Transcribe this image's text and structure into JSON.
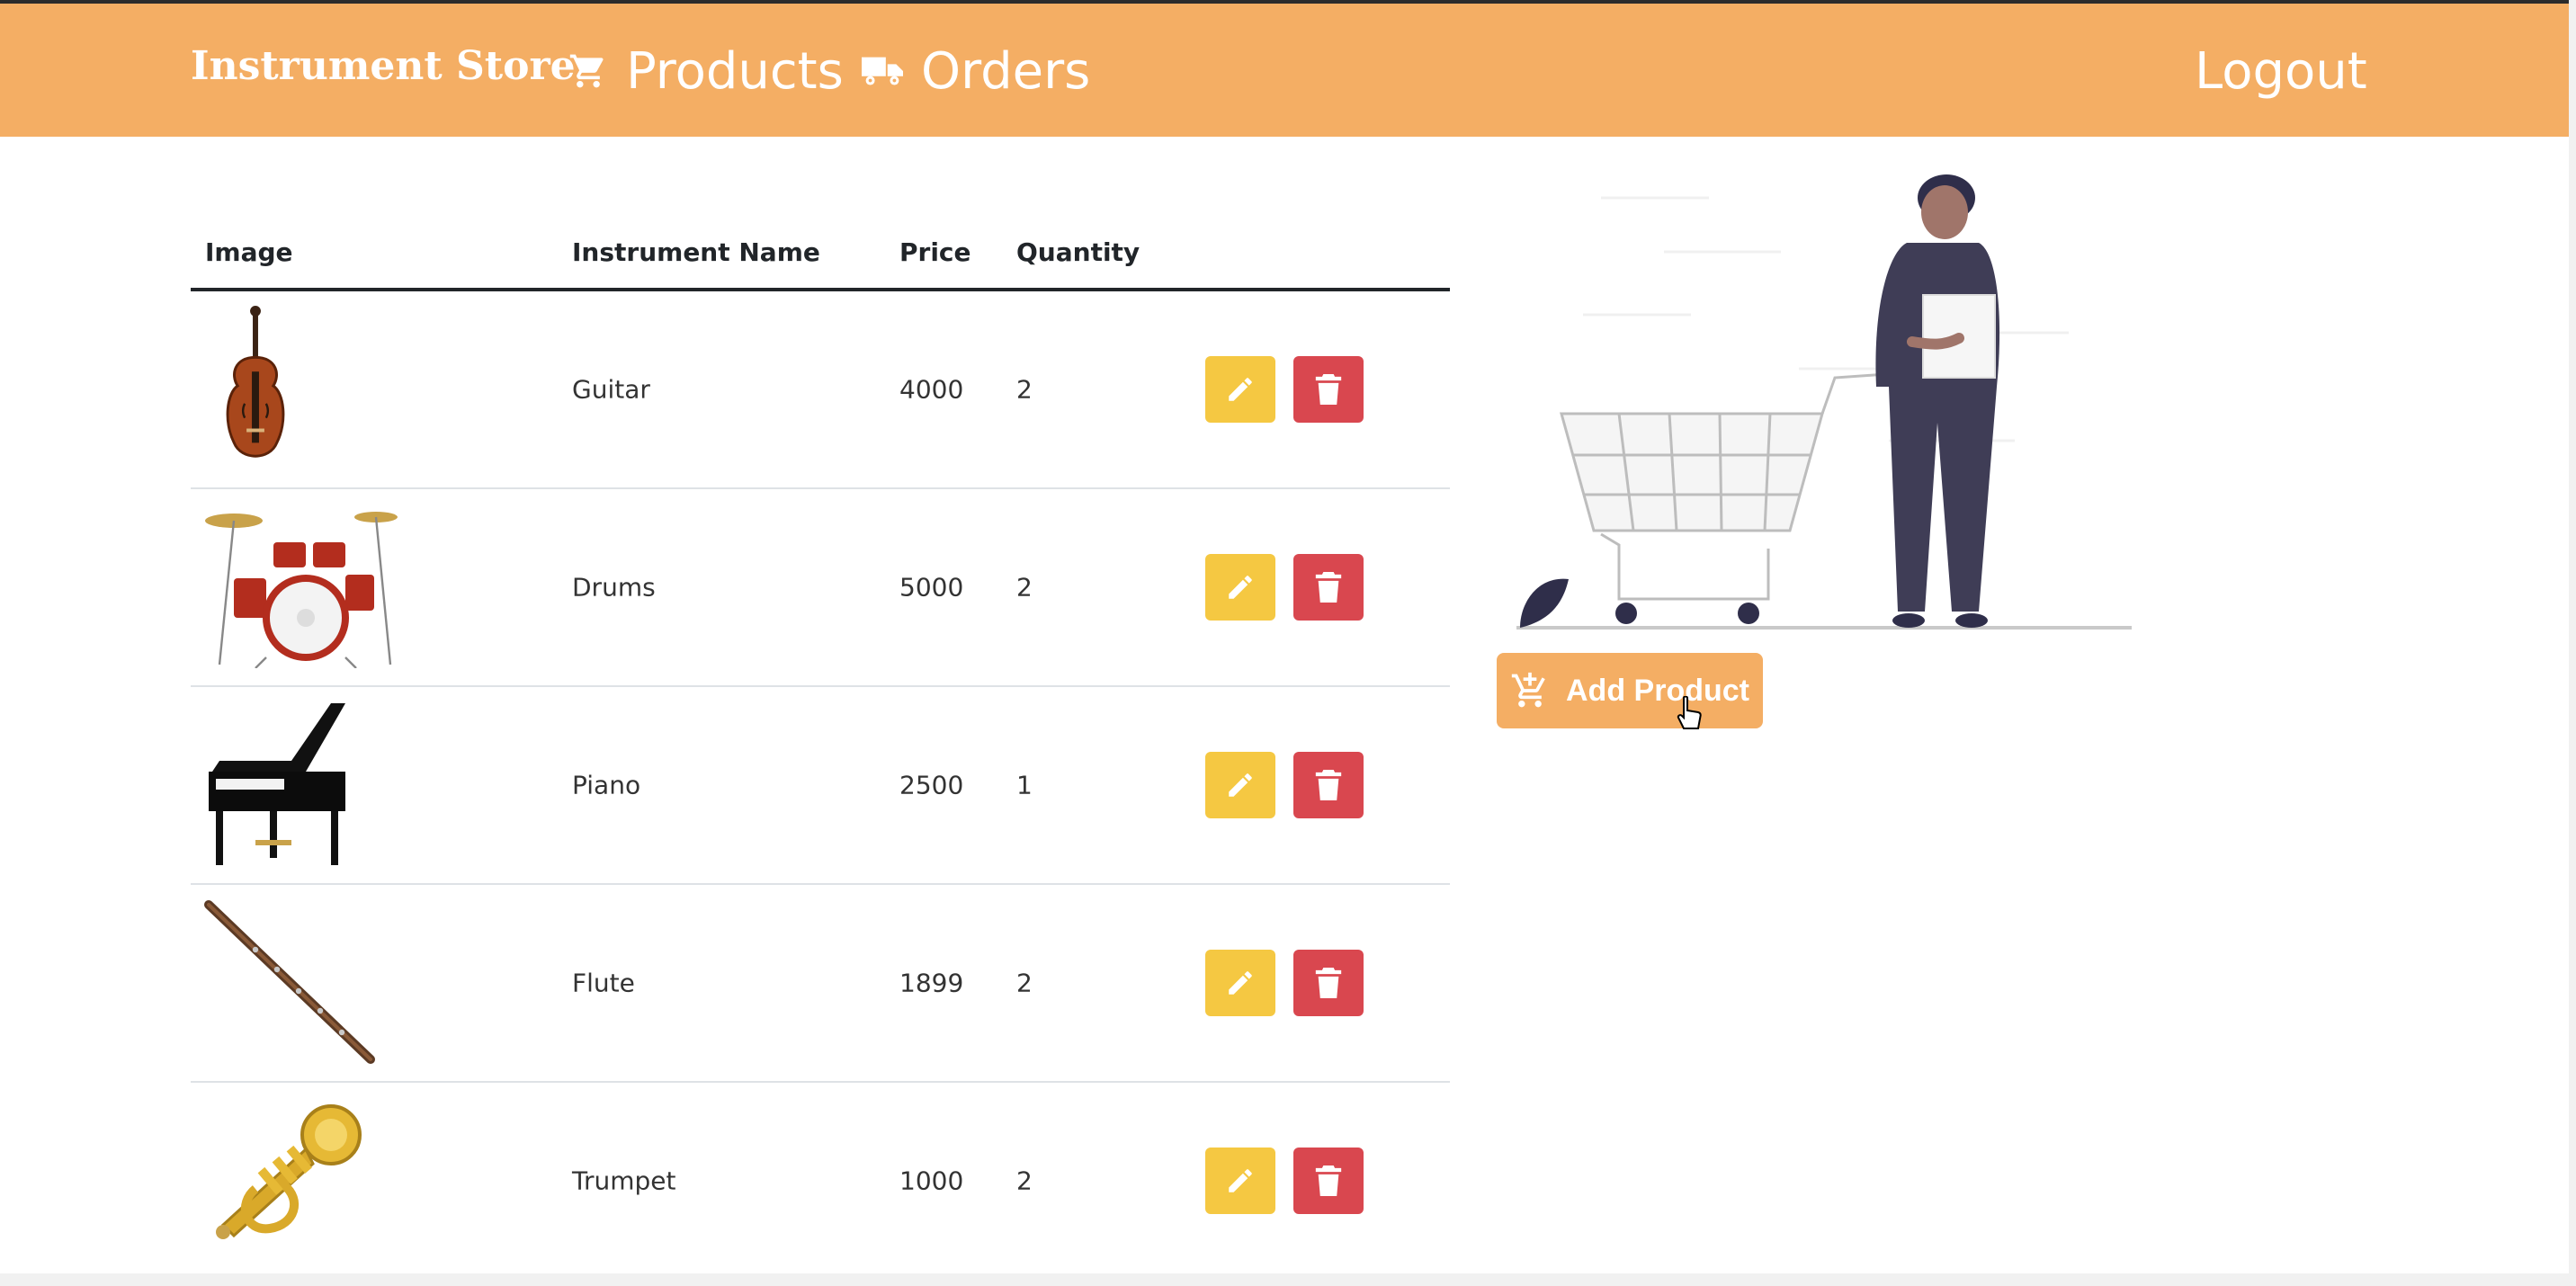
{
  "navbar": {
    "brand": "Instrument Store",
    "links": [
      {
        "label": "Products",
        "icon": "cart-icon"
      },
      {
        "label": "Orders",
        "icon": "truck-icon"
      }
    ],
    "logout": "Logout",
    "bg_color": "#f4ae64"
  },
  "table": {
    "headers": [
      "Image",
      "Instrument Name",
      "Price",
      "Quantity"
    ],
    "rows": [
      {
        "name": "Guitar",
        "price": "4000",
        "quantity": "2",
        "image": "violin"
      },
      {
        "name": "Drums",
        "price": "5000",
        "quantity": "2",
        "image": "drum-kit"
      },
      {
        "name": "Piano",
        "price": "2500",
        "quantity": "1",
        "image": "grand-piano"
      },
      {
        "name": "Flute",
        "price": "1899",
        "quantity": "2",
        "image": "flute"
      },
      {
        "name": "Trumpet",
        "price": "1000",
        "quantity": "2",
        "image": "trumpet"
      }
    ],
    "edit_color": "#f5c842",
    "delete_color": "#d9474f"
  },
  "sidebar": {
    "add_product": "Add Product"
  }
}
